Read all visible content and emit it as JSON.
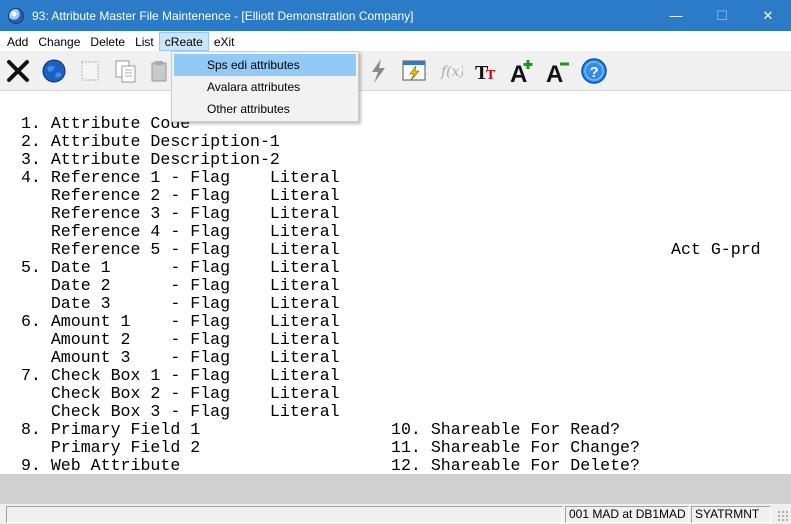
{
  "window": {
    "title": "93: Attribute Master File Maintenence - [Elliott Demonstration Company]",
    "minimize_glyph": "—",
    "maximize_glyph": "☐",
    "close_glyph": "✕"
  },
  "menu": {
    "items": [
      "Add",
      "Change",
      "Delete",
      "List",
      "cReate",
      "eXit"
    ],
    "active_index": 4
  },
  "toolbar": {
    "buttons": [
      "exit-icon",
      "globe-icon",
      "blank-page-icon",
      "copy-icon",
      "paste-icon",
      "lightning-icon",
      "screen-lightning-icon",
      "function-icon",
      "font-size-icon",
      "font-increase-icon",
      "font-decrease-icon",
      "help-icon"
    ]
  },
  "dropdown": {
    "items": [
      "Sps edi attributes",
      "Avalara attributes",
      "Other attributes"
    ],
    "highlighted_index": 0
  },
  "screen": {
    "l1": " 1. Attribute Code",
    "l2": " 2. Attribute Description-1",
    "l3": " 3. Attribute Description-2",
    "l4": " 4. Reference 1 - Flag    Literal",
    "l5": "    Reference 2 - Flag    Literal",
    "l6": "    Reference 3 - Flag    Literal",
    "l7": "    Reference 4 - Flag    Literal",
    "l8": "    Reference 5 - Flag    Literal",
    "l8_right": "Act G-prd",
    "l9": " 5. Date 1      - Flag    Literal",
    "l10": "    Date 2      - Flag    Literal",
    "l11": "    Date 3      - Flag    Literal",
    "l12": " 6. Amount 1    - Flag    Literal",
    "l13": "    Amount 2    - Flag    Literal",
    "l14": "    Amount 3    - Flag    Literal",
    "l15": " 7. Check Box 1 - Flag    Literal",
    "l16": "    Check Box 2 - Flag    Literal",
    "l17": "    Check Box 3 - Flag    Literal",
    "l18": " 8. Primary Field 1",
    "l18_right": "10. Shareable For Read?",
    "l19": "    Primary Field 2",
    "l19_right": "11. Shareable For Change?",
    "l20": " 9. Web Attribute",
    "l20_right": "12. Shareable For Delete?"
  },
  "status": {
    "panel1": "",
    "panel2": "001 MAD at DB1MAD",
    "panel3": "SYATRMNT"
  }
}
